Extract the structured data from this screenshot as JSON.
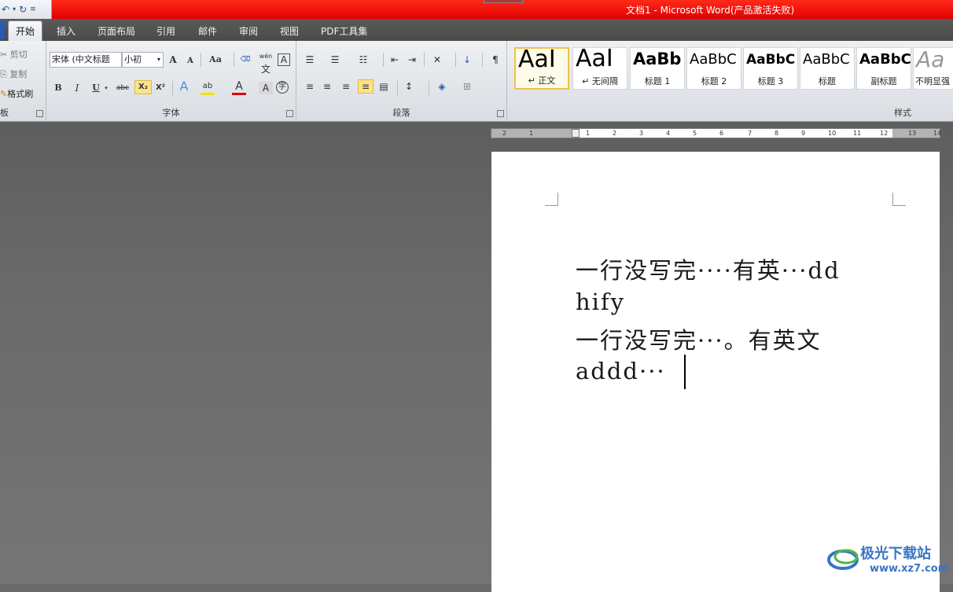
{
  "window": {
    "title": "文档1 - Microsoft Word(产品激活失败)",
    "qat": {
      "undo_icon": "undo-icon",
      "redo_icon": "redo-icon",
      "customize_icon": "customize-qat-icon"
    }
  },
  "tabs": [
    {
      "label": "开始",
      "active": true
    },
    {
      "label": "插入"
    },
    {
      "label": "页面布局"
    },
    {
      "label": "引用"
    },
    {
      "label": "邮件"
    },
    {
      "label": "审阅"
    },
    {
      "label": "视图"
    },
    {
      "label": "PDF工具集"
    }
  ],
  "ribbon": {
    "clipboard": {
      "cut": "剪切",
      "copy": "复制",
      "format_painter": "格式刷",
      "group_label": "板"
    },
    "font": {
      "font_name": "宋体 (中文标题",
      "font_size": "小初",
      "grow": "A",
      "shrink": "A",
      "change_case": "Aa",
      "phonetic": "wén",
      "phonetic_char": "文",
      "border_char": "A",
      "bold": "B",
      "italic": "I",
      "underline": "U",
      "strike": "abc",
      "subscript": "X₂",
      "superscript": "X²",
      "text_effect": "A",
      "highlight": "ab",
      "font_color": "A",
      "shading": "A",
      "enclose": "字",
      "group_label": "字体"
    },
    "paragraph": {
      "group_label": "段落"
    },
    "styles": {
      "group_label": "样式",
      "items": [
        {
          "sample": "AaI",
          "name": "↵ 正文",
          "selected": true
        },
        {
          "sample": "AaI",
          "name": "↵ 无间隔"
        },
        {
          "sample": "AaBb",
          "name": "标题 1"
        },
        {
          "sample": "AaBbC",
          "name": "标题 2"
        },
        {
          "sample": "AaBbC",
          "name": "标题 3"
        },
        {
          "sample": "AaBbC",
          "name": "标题"
        },
        {
          "sample": "AaBbC",
          "name": "副标题"
        },
        {
          "sample": "Aa",
          "name": "不明显强"
        }
      ]
    }
  },
  "ruler": {
    "ticks": [
      "2",
      "1",
      "1",
      "2",
      "3",
      "4",
      "5",
      "6",
      "7",
      "8",
      "9",
      "10",
      "11",
      "12",
      "13",
      "14"
    ]
  },
  "document": {
    "lines": [
      "一行没写完····有英···dd",
      "hify",
      "一行没写完···。有英文",
      "addd···"
    ]
  },
  "watermark": {
    "text": "极光下载站",
    "url": "www.xz7.com"
  },
  "colors": {
    "titlebar": "#e80000",
    "tabbar": "#525252",
    "ribbon": "#e6e9ed",
    "workspace": "#6a6a6a",
    "accent": "#f0c24a"
  }
}
